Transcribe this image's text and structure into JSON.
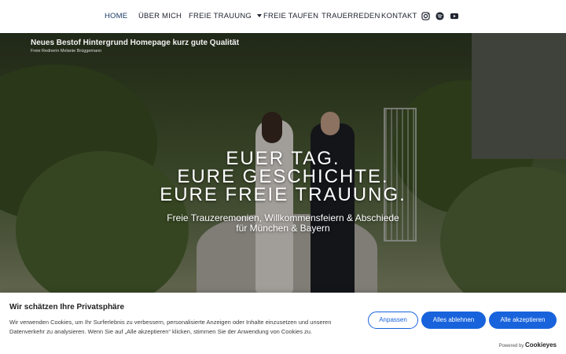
{
  "nav": {
    "items": [
      {
        "label": "HOME"
      },
      {
        "label": "ÜBER MICH"
      },
      {
        "label": "FREIE TRAUUNG"
      },
      {
        "label": "FREIE TAUFEN"
      },
      {
        "label": "TRAUERREDEN"
      },
      {
        "label": "KONTAKT"
      }
    ],
    "social_icons": [
      "instagram-icon",
      "spotify-icon",
      "youtube-icon"
    ],
    "active_color": "#1a3a63"
  },
  "hero": {
    "overlay_title": "Neues Bestof Hintergrund Homepage kurz gute Qualität",
    "overlay_subtitle": "Freie Rednerin Melanie Brüggemann",
    "headline": [
      "EUER TAG.",
      "EURE GESCHICHTE.",
      "EURE FREIE TRAUUNG."
    ],
    "tagline": [
      "Freie Trauzeremonien, Willkommensfeiern & Abschiede",
      "für München & Bayern"
    ]
  },
  "cookie": {
    "title": "Wir schätzen Ihre Privatsphäre",
    "text": "Wir verwenden Cookies, um Ihr Surferlebnis zu verbessern, personalisierte Anzeigen oder Inhalte einzusetzen und unseren Datenverkehr zu analysieren. Wenn Sie auf „Alle akzeptieren“ klicken, stimmen Sie der Anwendung von Cookies zu.",
    "btn_customize": "Anpassen",
    "btn_reject": "Alles ablehnen",
    "btn_accept": "Alle akzeptieren",
    "powered_by": "Powered by",
    "brand": "Cookieyes",
    "accent_color": "#1863dc"
  }
}
